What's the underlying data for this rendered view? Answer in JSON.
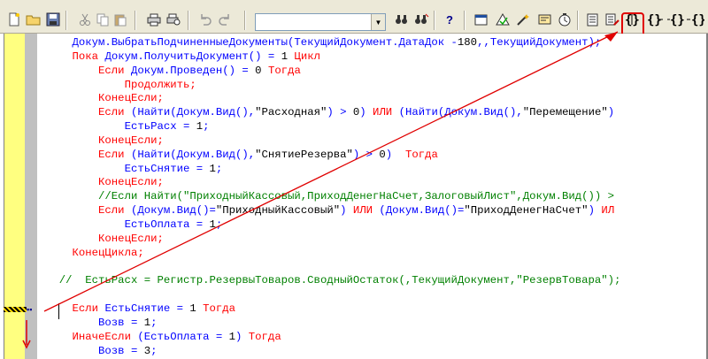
{
  "toolbar": {
    "icons": {
      "new": "new-document-icon",
      "open": "open-folder-icon",
      "save": "save-icon",
      "cut": "cut-icon",
      "copy": "copy-icon",
      "paste": "paste-icon",
      "print": "print-icon",
      "preview": "print-preview-icon",
      "undo": "undo-icon",
      "redo": "redo-icon",
      "find": "find-icon",
      "replace": "replace-icon",
      "help": "help-icon",
      "highlighted": "toggle-brackets-icon"
    },
    "search_value": "",
    "help_glyph": "?",
    "highlight_color": "#e00000"
  },
  "code": {
    "lines": [
      [
        {
          "t": "    "
        },
        {
          "c": "id",
          "t": "Докум.ВыбратьПодчиненныеДокументы(ТекущийДокумент.ДатаДок -"
        },
        {
          "c": "num",
          "t": "180"
        },
        {
          "c": "id",
          "t": ",,ТекущийДокумент);"
        }
      ],
      [
        {
          "t": "    "
        },
        {
          "c": "kw",
          "t": "Пока "
        },
        {
          "c": "id",
          "t": "Докум.ПолучитьДокумент() = "
        },
        {
          "c": "num",
          "t": "1"
        },
        {
          "c": "kw",
          "t": " Цикл"
        }
      ],
      [
        {
          "t": "        "
        },
        {
          "c": "kw",
          "t": "Если "
        },
        {
          "c": "id",
          "t": "Докум.Проведен() = "
        },
        {
          "c": "num",
          "t": "0"
        },
        {
          "c": "kw",
          "t": " Тогда"
        }
      ],
      [
        {
          "t": "            "
        },
        {
          "c": "kw",
          "t": "Продолжить;"
        }
      ],
      [
        {
          "t": "        "
        },
        {
          "c": "kw",
          "t": "КонецЕсли;"
        }
      ],
      [
        {
          "t": "        "
        },
        {
          "c": "kw",
          "t": "Если "
        },
        {
          "c": "id",
          "t": "(Найти(Докум.Вид(),"
        },
        {
          "c": "str",
          "t": "\"Расходная\""
        },
        {
          "c": "id",
          "t": ") > "
        },
        {
          "c": "num",
          "t": "0"
        },
        {
          "c": "id",
          "t": ") "
        },
        {
          "c": "kw",
          "t": "ИЛИ "
        },
        {
          "c": "id",
          "t": "(Найти(Докум.Вид(),"
        },
        {
          "c": "str",
          "t": "\"Перемещение\""
        },
        {
          "c": "id",
          "t": ")"
        }
      ],
      [
        {
          "t": "            "
        },
        {
          "c": "id",
          "t": "ЕстьРасх = "
        },
        {
          "c": "num",
          "t": "1"
        },
        {
          "c": "id",
          "t": ";"
        }
      ],
      [
        {
          "t": "        "
        },
        {
          "c": "kw",
          "t": "КонецЕсли;"
        }
      ],
      [
        {
          "t": "        "
        },
        {
          "c": "kw",
          "t": "Если "
        },
        {
          "c": "id",
          "t": "(Найти(Докум.Вид(),"
        },
        {
          "c": "str",
          "t": "\"СнятиеРезерва\""
        },
        {
          "c": "id",
          "t": ") > "
        },
        {
          "c": "num",
          "t": "0"
        },
        {
          "c": "id",
          "t": ")  "
        },
        {
          "c": "kw",
          "t": "Тогда"
        }
      ],
      [
        {
          "t": "            "
        },
        {
          "c": "id",
          "t": "ЕстьСнятие = "
        },
        {
          "c": "num",
          "t": "1"
        },
        {
          "c": "id",
          "t": ";"
        }
      ],
      [
        {
          "t": "        "
        },
        {
          "c": "kw",
          "t": "КонецЕсли;"
        }
      ],
      [
        {
          "t": "        "
        },
        {
          "c": "cm",
          "t": "//Если Найти(\"ПриходныйКассовый,ПриходДенегНаСчет,ЗалоговыйЛист\",Докум.Вид()) >"
        }
      ],
      [
        {
          "t": "        "
        },
        {
          "c": "kw",
          "t": "Если "
        },
        {
          "c": "id",
          "t": "(Докум.Вид()="
        },
        {
          "c": "str",
          "t": "\"ПриходныйКассовый\""
        },
        {
          "c": "id",
          "t": ") "
        },
        {
          "c": "kw",
          "t": "ИЛИ "
        },
        {
          "c": "id",
          "t": "(Докум.Вид()="
        },
        {
          "c": "str",
          "t": "\"ПриходДенегНаСчет\""
        },
        {
          "c": "id",
          "t": ") "
        },
        {
          "c": "kw",
          "t": "ИЛ"
        }
      ],
      [
        {
          "t": "            "
        },
        {
          "c": "id",
          "t": "ЕстьОплата = "
        },
        {
          "c": "num",
          "t": "1"
        },
        {
          "c": "id",
          "t": ";"
        }
      ],
      [
        {
          "t": "        "
        },
        {
          "c": "kw",
          "t": "КонецЕсли;"
        }
      ],
      [
        {
          "t": "    "
        },
        {
          "c": "kw",
          "t": "КонецЦикла;"
        }
      ],
      [
        {
          "t": ""
        }
      ],
      [
        {
          "t": "  "
        },
        {
          "c": "cm",
          "t": "//  ЕстьРасх = Регистр.РезервыТоваров.СводныйОстаток(,ТекущийДокумент,\"РезервТовара\");"
        }
      ],
      [
        {
          "t": ""
        }
      ],
      [
        {
          "t": "    "
        },
        {
          "c": "kw",
          "t": "Если "
        },
        {
          "c": "id",
          "t": "ЕстьСнятие = "
        },
        {
          "c": "num",
          "t": "1"
        },
        {
          "c": "kw",
          "t": " Тогда"
        }
      ],
      [
        {
          "t": "        "
        },
        {
          "c": "id",
          "t": "Возв = "
        },
        {
          "c": "num",
          "t": "1"
        },
        {
          "c": "id",
          "t": ";"
        }
      ],
      [
        {
          "t": "    "
        },
        {
          "c": "kw",
          "t": "ИначеЕсли "
        },
        {
          "c": "id",
          "t": "(ЕстьОплата = "
        },
        {
          "c": "num",
          "t": "1"
        },
        {
          "c": "id",
          "t": ") "
        },
        {
          "c": "kw",
          "t": "Тогда"
        }
      ],
      [
        {
          "t": "        "
        },
        {
          "c": "id",
          "t": "Возв = "
        },
        {
          "c": "num",
          "t": "3"
        },
        {
          "c": "id",
          "t": ";"
        }
      ]
    ]
  },
  "annotation": {
    "arrow_color": "#e00000",
    "bookmark_icon": "bookmark-marker-icon"
  }
}
